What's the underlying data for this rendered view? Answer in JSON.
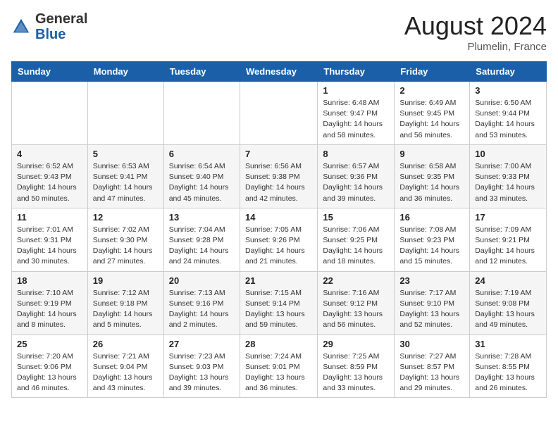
{
  "header": {
    "logo_general": "General",
    "logo_blue": "Blue",
    "month": "August 2024",
    "location": "Plumelin, France"
  },
  "weekdays": [
    "Sunday",
    "Monday",
    "Tuesday",
    "Wednesday",
    "Thursday",
    "Friday",
    "Saturday"
  ],
  "weeks": [
    [
      null,
      null,
      null,
      null,
      {
        "day": 1,
        "sunrise": "6:48 AM",
        "sunset": "9:47 PM",
        "daylight": "14 hours and 58 minutes."
      },
      {
        "day": 2,
        "sunrise": "6:49 AM",
        "sunset": "9:45 PM",
        "daylight": "14 hours and 56 minutes."
      },
      {
        "day": 3,
        "sunrise": "6:50 AM",
        "sunset": "9:44 PM",
        "daylight": "14 hours and 53 minutes."
      }
    ],
    [
      {
        "day": 4,
        "sunrise": "6:52 AM",
        "sunset": "9:43 PM",
        "daylight": "14 hours and 50 minutes."
      },
      {
        "day": 5,
        "sunrise": "6:53 AM",
        "sunset": "9:41 PM",
        "daylight": "14 hours and 47 minutes."
      },
      {
        "day": 6,
        "sunrise": "6:54 AM",
        "sunset": "9:40 PM",
        "daylight": "14 hours and 45 minutes."
      },
      {
        "day": 7,
        "sunrise": "6:56 AM",
        "sunset": "9:38 PM",
        "daylight": "14 hours and 42 minutes."
      },
      {
        "day": 8,
        "sunrise": "6:57 AM",
        "sunset": "9:36 PM",
        "daylight": "14 hours and 39 minutes."
      },
      {
        "day": 9,
        "sunrise": "6:58 AM",
        "sunset": "9:35 PM",
        "daylight": "14 hours and 36 minutes."
      },
      {
        "day": 10,
        "sunrise": "7:00 AM",
        "sunset": "9:33 PM",
        "daylight": "14 hours and 33 minutes."
      }
    ],
    [
      {
        "day": 11,
        "sunrise": "7:01 AM",
        "sunset": "9:31 PM",
        "daylight": "14 hours and 30 minutes."
      },
      {
        "day": 12,
        "sunrise": "7:02 AM",
        "sunset": "9:30 PM",
        "daylight": "14 hours and 27 minutes."
      },
      {
        "day": 13,
        "sunrise": "7:04 AM",
        "sunset": "9:28 PM",
        "daylight": "14 hours and 24 minutes."
      },
      {
        "day": 14,
        "sunrise": "7:05 AM",
        "sunset": "9:26 PM",
        "daylight": "14 hours and 21 minutes."
      },
      {
        "day": 15,
        "sunrise": "7:06 AM",
        "sunset": "9:25 PM",
        "daylight": "14 hours and 18 minutes."
      },
      {
        "day": 16,
        "sunrise": "7:08 AM",
        "sunset": "9:23 PM",
        "daylight": "14 hours and 15 minutes."
      },
      {
        "day": 17,
        "sunrise": "7:09 AM",
        "sunset": "9:21 PM",
        "daylight": "14 hours and 12 minutes."
      }
    ],
    [
      {
        "day": 18,
        "sunrise": "7:10 AM",
        "sunset": "9:19 PM",
        "daylight": "14 hours and 8 minutes."
      },
      {
        "day": 19,
        "sunrise": "7:12 AM",
        "sunset": "9:18 PM",
        "daylight": "14 hours and 5 minutes."
      },
      {
        "day": 20,
        "sunrise": "7:13 AM",
        "sunset": "9:16 PM",
        "daylight": "14 hours and 2 minutes."
      },
      {
        "day": 21,
        "sunrise": "7:15 AM",
        "sunset": "9:14 PM",
        "daylight": "13 hours and 59 minutes."
      },
      {
        "day": 22,
        "sunrise": "7:16 AM",
        "sunset": "9:12 PM",
        "daylight": "13 hours and 56 minutes."
      },
      {
        "day": 23,
        "sunrise": "7:17 AM",
        "sunset": "9:10 PM",
        "daylight": "13 hours and 52 minutes."
      },
      {
        "day": 24,
        "sunrise": "7:19 AM",
        "sunset": "9:08 PM",
        "daylight": "13 hours and 49 minutes."
      }
    ],
    [
      {
        "day": 25,
        "sunrise": "7:20 AM",
        "sunset": "9:06 PM",
        "daylight": "13 hours and 46 minutes."
      },
      {
        "day": 26,
        "sunrise": "7:21 AM",
        "sunset": "9:04 PM",
        "daylight": "13 hours and 43 minutes."
      },
      {
        "day": 27,
        "sunrise": "7:23 AM",
        "sunset": "9:03 PM",
        "daylight": "13 hours and 39 minutes."
      },
      {
        "day": 28,
        "sunrise": "7:24 AM",
        "sunset": "9:01 PM",
        "daylight": "13 hours and 36 minutes."
      },
      {
        "day": 29,
        "sunrise": "7:25 AM",
        "sunset": "8:59 PM",
        "daylight": "13 hours and 33 minutes."
      },
      {
        "day": 30,
        "sunrise": "7:27 AM",
        "sunset": "8:57 PM",
        "daylight": "13 hours and 29 minutes."
      },
      {
        "day": 31,
        "sunrise": "7:28 AM",
        "sunset": "8:55 PM",
        "daylight": "13 hours and 26 minutes."
      }
    ]
  ]
}
